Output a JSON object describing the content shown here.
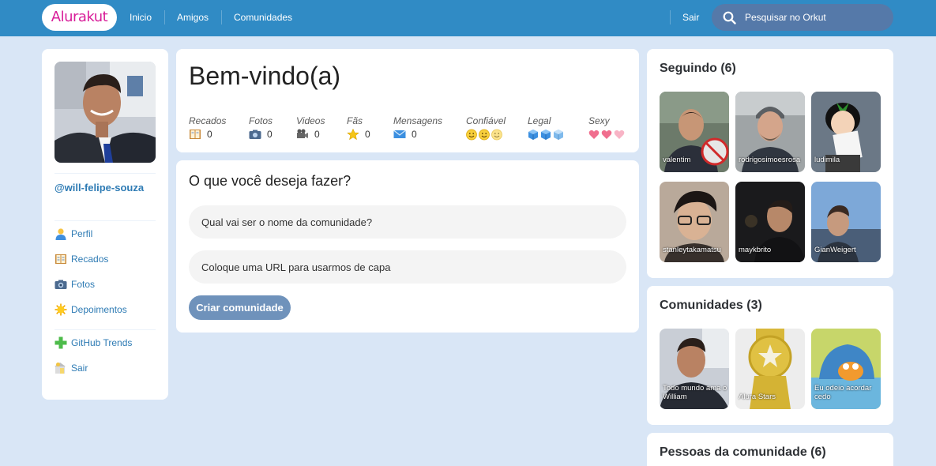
{
  "header": {
    "logo": "Alurakut",
    "nav": [
      "Inicio",
      "Amigos",
      "Comunidades"
    ],
    "logout": "Sair",
    "search_placeholder": "Pesquisar no Orkut"
  },
  "profile": {
    "username": "@will-felipe-souza",
    "menu": [
      "Perfil",
      "Recados",
      "Fotos",
      "Depoimentos"
    ],
    "menu_extra": [
      "GitHub Trends",
      "Sair"
    ]
  },
  "welcome": {
    "title": "Bem-vindo(a)",
    "stats": [
      {
        "label": "Recados",
        "value": "0",
        "icon": "notebook-icon"
      },
      {
        "label": "Fotos",
        "value": "0",
        "icon": "camera-icon"
      },
      {
        "label": "Videos",
        "value": "0",
        "icon": "video-camera-icon"
      },
      {
        "label": "Fãs",
        "value": "0",
        "icon": "star-icon"
      },
      {
        "label": "Mensagens",
        "value": "0",
        "icon": "envelope-icon"
      }
    ],
    "ratings": [
      {
        "label": "Confiável",
        "icon": "smiley-icon",
        "count": 3
      },
      {
        "label": "Legal",
        "icon": "ice-cube-icon",
        "count": 3
      },
      {
        "label": "Sexy",
        "icon": "heart-icon",
        "count": 3
      }
    ]
  },
  "create_community": {
    "title": "O que você deseja fazer?",
    "name_placeholder": "Qual vai ser o nome da comunidade?",
    "url_placeholder": "Coloque uma URL para usarmos de capa",
    "submit": "Criar comunidade"
  },
  "following": {
    "title": "Seguindo (6)",
    "items": [
      "valentim",
      "rodrigosimoesrosa",
      "ludimila",
      "stanleytakamatsu",
      "maykbrito",
      "GianWeigert"
    ]
  },
  "communities": {
    "title": "Comunidades (3)",
    "items": [
      "Todo mundo ama o William",
      "Alura Stars",
      "Eu odeio acordar cedo"
    ]
  },
  "community_people": {
    "title": "Pessoas da comunidade (6)"
  },
  "colors": {
    "header_bg": "#308BC5",
    "page_bg": "#D9E6F6",
    "link": "#2E7BB4",
    "logo": "#D81D99",
    "button": "#6F92BB"
  }
}
